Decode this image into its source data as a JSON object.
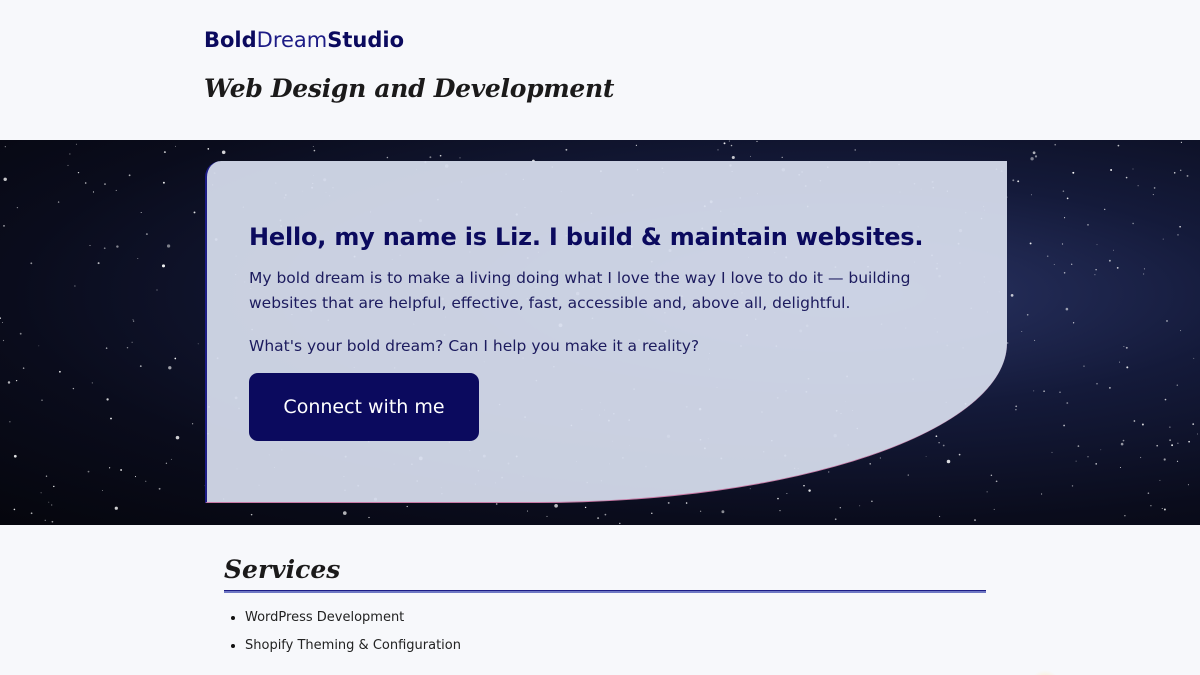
{
  "header": {
    "logo": {
      "part1": "Bold",
      "part2": "Dream",
      "part3": "Studio"
    },
    "tagline": "Web Design and Development"
  },
  "hero": {
    "heading": "Hello, my name is Liz. I build & maintain websites.",
    "intro": "My bold dream is to make a living doing what I love the way I love to do it — building websites that are helpful, effective, fast, accessible and, above all, delightful.",
    "question": "What's your bold dream? Can I help you make it a reality?",
    "cta_label": "Connect with me"
  },
  "services": {
    "heading": "Services",
    "items": [
      "WordPress Development",
      "Shopify Theming & Configuration"
    ]
  },
  "colors": {
    "brand_navy": "#0b0a5e",
    "card_bg": "#d6dcec",
    "page_bg": "#f7f8fb"
  }
}
